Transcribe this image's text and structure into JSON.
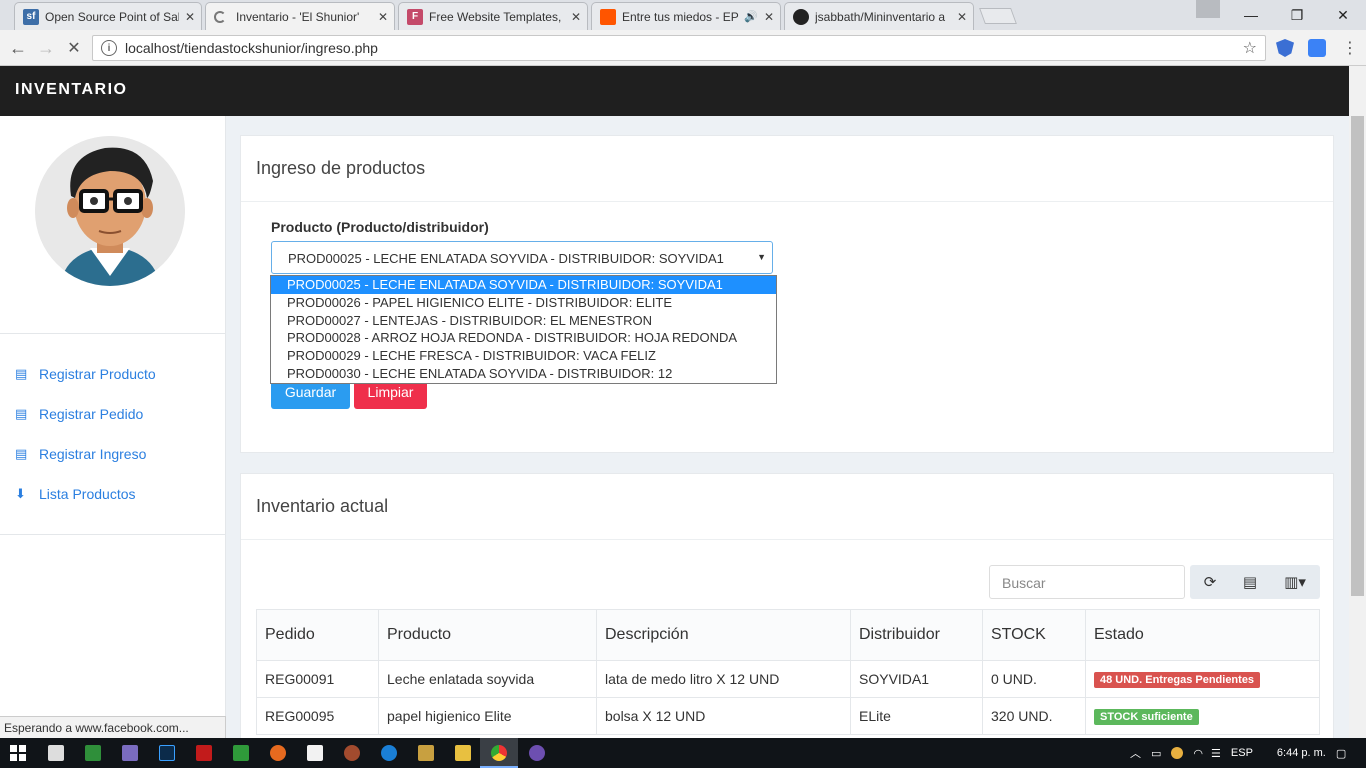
{
  "browser": {
    "tabs": [
      {
        "title": "Open Source Point of Sal",
        "favicon": "sf-icon",
        "fav_color": "#3d6ea8",
        "fav_text": "sf"
      },
      {
        "title": "Inventario - 'El Shunior'",
        "favicon": "loading-spinner-icon",
        "fav_color": "#e8eaed",
        "fav_text": ""
      },
      {
        "title": "Free Website Templates,",
        "favicon": "f-icon",
        "fav_color": "#c44a6a",
        "fav_text": "F"
      },
      {
        "title": "Entre tus miedos - EP",
        "favicon": "soundcloud-icon",
        "fav_color": "#ff5500",
        "fav_text": ""
      },
      {
        "title": "jsabbath/Mininventario a",
        "favicon": "github-icon",
        "fav_color": "#222222",
        "fav_text": ""
      }
    ],
    "url": "localhost/tiendastockshunior/ingreso.php",
    "status": "Esperando a www.facebook.com..."
  },
  "app": {
    "brand": "INVENTARIO",
    "sidebar": {
      "items": [
        {
          "label": "Registrar Producto",
          "icon": "list-icon"
        },
        {
          "label": "Registrar Pedido",
          "icon": "list-icon"
        },
        {
          "label": "Registrar Ingreso",
          "icon": "list-icon"
        },
        {
          "label": "Lista Productos",
          "icon": "download-icon"
        }
      ]
    },
    "ingreso": {
      "title": "Ingreso de productos",
      "product_label": "Producto (Producto/distribuidor)",
      "selected": "PROD00025 - LECHE ENLATADA SOYVIDA - DISTRIBUIDOR: SOYVIDA1",
      "options": [
        "PROD00025 - LECHE ENLATADA SOYVIDA - DISTRIBUIDOR: SOYVIDA1",
        "PROD00026 - PAPEL HIGIENICO ELITE - DISTRIBUIDOR: ELITE",
        "PROD00027 - LENTEJAS - DISTRIBUIDOR: EL MENESTRON",
        "PROD00028 - ARROZ HOJA REDONDA - DISTRIBUIDOR: HOJA REDONDA",
        "PROD00029 - LECHE FRESCA - DISTRIBUIDOR: VACA FELIZ",
        "PROD00030 - LECHE ENLATADA SOYVIDA - DISTRIBUIDOR: 12"
      ],
      "save_label": "Guardar",
      "clear_label": "Limpiar"
    },
    "inventario": {
      "title": "Inventario actual",
      "search_placeholder": "Buscar",
      "columns": [
        "Pedido",
        "Producto",
        "Descripción",
        "Distribuidor",
        "STOCK",
        "Estado"
      ],
      "rows": [
        {
          "pedido": "REG00091",
          "producto": "Leche enlatada soyvida",
          "descripcion": "lata de medo litro X 12 UND",
          "distribuidor": "SOYVIDA1",
          "stock": "0 UND.",
          "estado": "48 UND. Entregas Pendientes",
          "estado_color": "#d9534f"
        },
        {
          "pedido": "REG00095",
          "producto": "papel higienico Elite",
          "descripcion": "bolsa X 12 UND",
          "distribuidor": "ELite",
          "stock": "320 UND.",
          "estado": "STOCK suficiente",
          "estado_color": "#5cb85c"
        }
      ]
    }
  },
  "taskbar": {
    "lang": "ESP",
    "time": "6:44 p. m."
  }
}
